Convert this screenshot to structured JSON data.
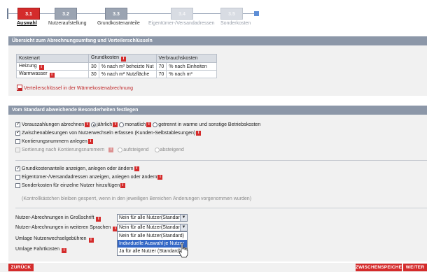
{
  "wizard": {
    "steps": [
      {
        "number": "3.1",
        "label": "Auswahl",
        "state": "active"
      },
      {
        "number": "3.2",
        "label": "Nutzeraufstellung",
        "state": "done"
      },
      {
        "number": "3.3",
        "label": "Grundkostenanteile",
        "state": "done"
      },
      {
        "number": "3.4",
        "label": "Eigentümer-/Versandadressen",
        "state": "future"
      },
      {
        "number": "3.5",
        "label": "Sonderkosten",
        "state": "future"
      }
    ]
  },
  "section1": {
    "title": "Übersicht zum Abrechnungsumfang und Verteilerschlüsseln",
    "table": {
      "headers": [
        "Kostenart",
        "Grundkosten",
        "Verbrauchskosten"
      ],
      "rows": [
        {
          "name": "Heizung",
          "grund_value": "30",
          "grund_text": "% nach m² beheizte Nut",
          "verb_value": "70",
          "verb_text": "% nach Einheiten"
        },
        {
          "name": "Warmwasser",
          "grund_value": "30",
          "grund_text": "% nach m² Nutzfläche",
          "verb_value": "70",
          "verb_text": "% nach m³"
        }
      ]
    },
    "pdf_link": "Verteilerschlüssel in der Wärmekostenabrechnung"
  },
  "section2": {
    "title": "Vom Standard abweichende Besonderheiten festlegen",
    "vorauszahlungen": {
      "label": "Vorauszahlungen abrechnen",
      "options": [
        "jährlich",
        "monatlich",
        "getrennt in warme und sonstige Betriebskosten"
      ]
    },
    "zwischenablesungen": "Zwischenablesungen von Nutzerwechseln erfassen (Kunden-Selbstablesungen)",
    "kontierung": "Kontierungsnummern anlegen",
    "sortierung": {
      "label": "Sortierung nach Kontierungsnummern",
      "options": [
        "aufsteigend",
        "absteigend"
      ]
    },
    "grundkostenanteile": "Grundkostenanteile anzeigen, anlegen oder ändern",
    "eigentuemer": "Eigentümer-/Versandadressen anzeigen, anlegen oder ändern",
    "sonderkosten": "Sonderkosten für einzelne Nutzer hinzufügen",
    "hint": "(Kontrollkästchen bleiben gesperrt, wenn in den jeweiligen Bereichen Änderungen vorgenommen wurden)",
    "grossschrift_label": "Nutzer-Abrechnungen in Großschrift",
    "grossschrift_value": "Nein für alle Nutzer(Standard)",
    "sprachen_label": "Nutzer-Abrechnungen in weiteren Sprachen",
    "sprachen_value": "Nein für alle Nutzer(Standard)",
    "sprachen_options": [
      "Nein für alle Nutzer(Standard)",
      "Individuelle Auswahl je Nutzer",
      "Ja für alle Nutzer (Standard)"
    ],
    "umlage_nutzerwechsel_label": "Umlage Nutzerwechselgebühren",
    "umlage_fahrt_label": "Umlage Fahrtkosten"
  },
  "buttons": {
    "back": "ZURÜCK",
    "save": "ZWISCHENSPEICHERN",
    "next": "WEITER"
  }
}
